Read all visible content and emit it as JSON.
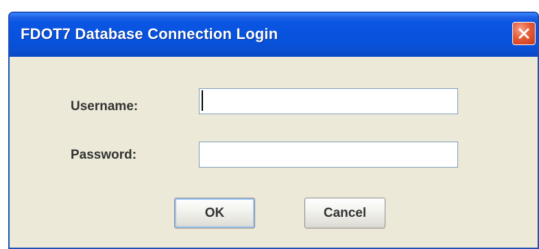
{
  "window": {
    "title": "FDOT7 Database Connection Login"
  },
  "form": {
    "username_label": "Username:",
    "username_value": "",
    "password_label": "Password:",
    "password_value": ""
  },
  "buttons": {
    "ok_label": "OK",
    "cancel_label": "Cancel"
  },
  "icons": {
    "close": "close-icon"
  },
  "colors": {
    "titlebar": "#0752dc",
    "window_border": "#1c4fb8",
    "dialog_background": "#ece9d8",
    "close_button": "#e55b36"
  }
}
